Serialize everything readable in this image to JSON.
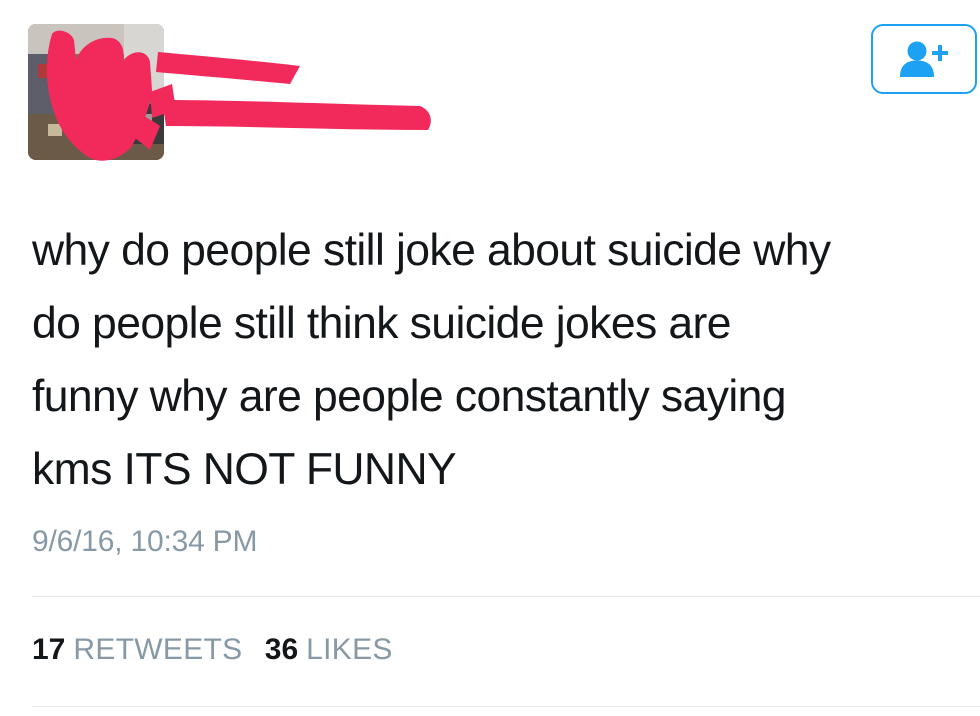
{
  "tweet": {
    "text_lines": [
      "why do people still joke about suicide why",
      "do people still think suicide jokes are",
      "funny why are people constantly saying",
      "kms ITS NOT FUNNY"
    ],
    "timestamp": "9/6/16, 10:34 PM"
  },
  "stats": {
    "retweets_count": "17",
    "retweets_label": "RETWEETS",
    "likes_count": "36",
    "likes_label": "LIKES"
  },
  "icons": {
    "follow": "add-user-icon"
  },
  "colors": {
    "accent": "#1da1f2",
    "redaction": "#f2295b",
    "secondary_text": "#8899a6",
    "primary_text": "#14171a",
    "divider": "#e1e8ed"
  }
}
